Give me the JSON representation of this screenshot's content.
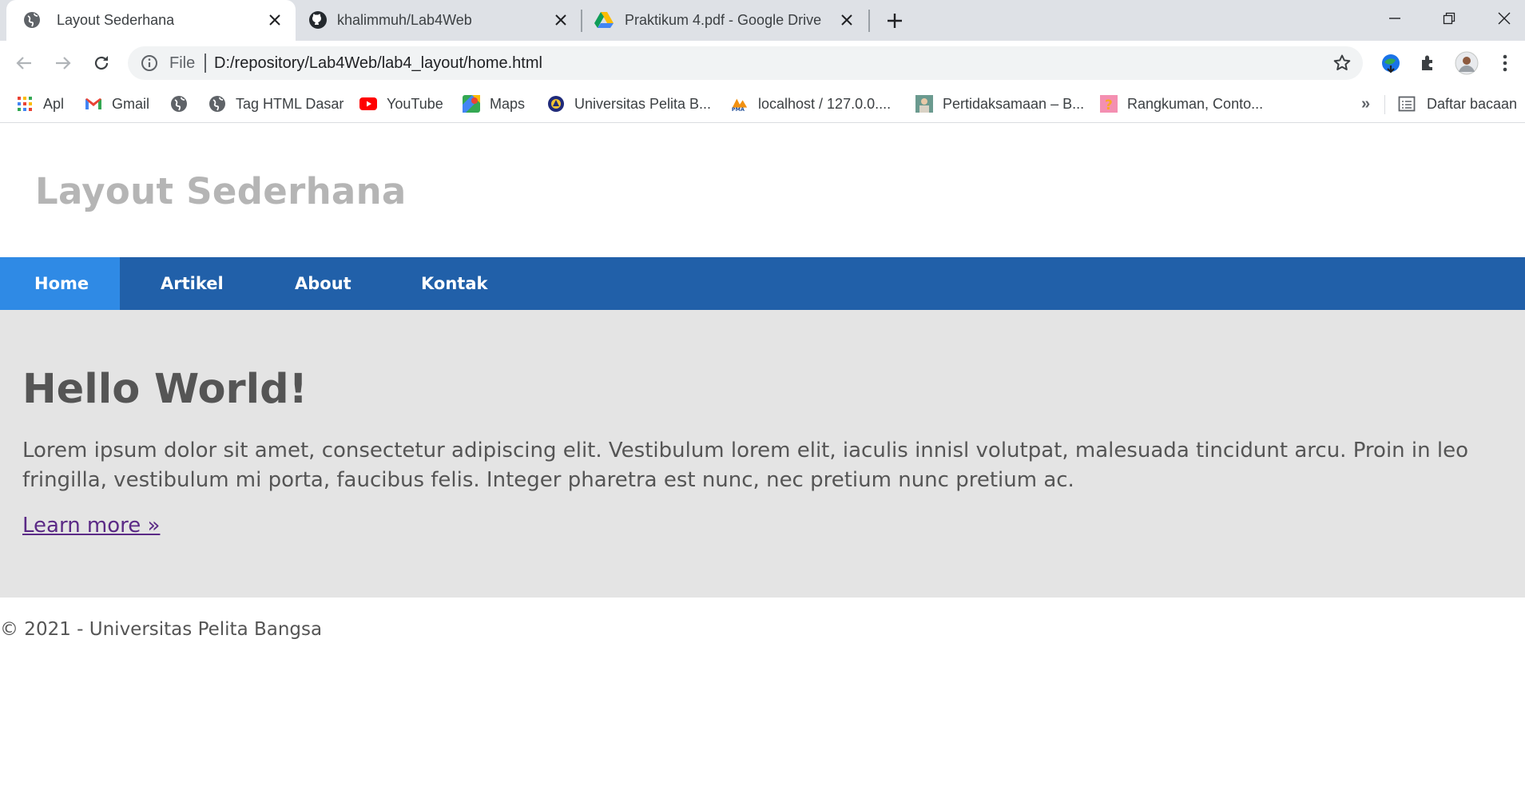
{
  "browser": {
    "tabs": [
      {
        "title": "Layout Sederhana",
        "icon": "globe-icon",
        "active": true
      },
      {
        "title": "khalimmuh/Lab4Web",
        "icon": "github-icon",
        "active": false
      },
      {
        "title": "Praktikum 4.pdf - Google Drive",
        "icon": "google-drive-icon",
        "active": false
      }
    ],
    "address_bar": {
      "scheme_label": "File",
      "url": "D:/repository/Lab4Web/lab4_layout/home.html"
    },
    "bookmarks": [
      {
        "label": "Apl",
        "icon": "apps-grid-icon"
      },
      {
        "label": "Gmail",
        "icon": "gmail-icon"
      },
      {
        "label": "",
        "icon": "globe-icon"
      },
      {
        "label": "Tag HTML Dasar",
        "icon": "globe-icon"
      },
      {
        "label": "YouTube",
        "icon": "youtube-icon"
      },
      {
        "label": "Maps",
        "icon": "maps-icon"
      },
      {
        "label": "Universitas Pelita B...",
        "icon": "university-icon"
      },
      {
        "label": "localhost / 127.0.0....",
        "icon": "phpmyadmin-icon"
      },
      {
        "label": "Pertidaksamaan – B...",
        "icon": "bookmark-thumb-icon"
      },
      {
        "label": "Rangkuman, Conto...",
        "icon": "question-icon"
      }
    ],
    "bookmarks_overflow": "»",
    "reading_list": "Daftar bacaan"
  },
  "page": {
    "site_title": "Layout Sederhana",
    "nav": [
      {
        "label": "Home",
        "active": true
      },
      {
        "label": "Artikel",
        "active": false
      },
      {
        "label": "About",
        "active": false
      },
      {
        "label": "Kontak",
        "active": false
      }
    ],
    "hero": {
      "heading": "Hello World!",
      "body": "Lorem ipsum dolor sit amet, consectetur adipiscing elit. Vestibulum lorem elit, iaculis innisl volutpat, malesuada tincidunt arcu. Proin in leo fringilla, vestibulum mi porta, faucibus felis. Integer pharetra est nunc, nec pretium nunc pretium ac.",
      "link": "Learn more »"
    },
    "footer": "© 2021 - Universitas Pelita Bangsa"
  },
  "colors": {
    "nav_bg": "#2160a9",
    "nav_active": "#2f8ae5",
    "hero_bg": "#e4e4e4",
    "title_gray": "#b5b5b5",
    "text_gray": "#555555",
    "link_visited": "#5b2a86"
  }
}
